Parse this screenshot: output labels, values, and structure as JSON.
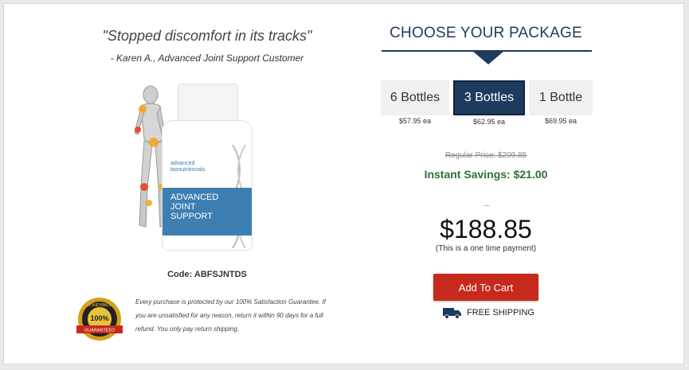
{
  "testimonial": {
    "quote": "\"Stopped discomfort in its tracks\"",
    "author": "- Karen A., Advanced Joint Support Customer"
  },
  "product": {
    "brand_line1": "advanced",
    "brand_line2": "bionutritionals",
    "name_line1": "ADVANCED",
    "name_line2": "JOINT",
    "name_line3": "SUPPORT",
    "code": "Code: ABFSJNTDS"
  },
  "guarantee": {
    "badge_top": "MONEYBACK",
    "badge_center": "100%",
    "badge_ribbon": "GUARANTEED",
    "text": "Every purchase is protected by our 100% Satisfaction Guarantee. If you are unsatisfied for any reason, return it within 90 days for a full refund. You only pay return shipping."
  },
  "package": {
    "title": "CHOOSE YOUR PACKAGE",
    "options": [
      {
        "label": "6 Bottles",
        "each": "$57.95 ea"
      },
      {
        "label": "3 Bottles",
        "each": "$62.95 ea"
      },
      {
        "label": "1 Bottle",
        "each": "$69.95 ea"
      }
    ],
    "selected_index": 1,
    "regular_price": "Regular Price: $209.85",
    "savings": "Instant Savings: $21.00",
    "price": "$188.85",
    "payment_note": "(This is a one time payment)",
    "cart_label": "Add To Cart",
    "shipping": "FREE SHIPPING"
  },
  "colors": {
    "navy": "#1f3a5f",
    "cart_red": "#c62a1c",
    "savings_green": "#2f6f3a",
    "bottle_blue": "#3d7fb3"
  }
}
